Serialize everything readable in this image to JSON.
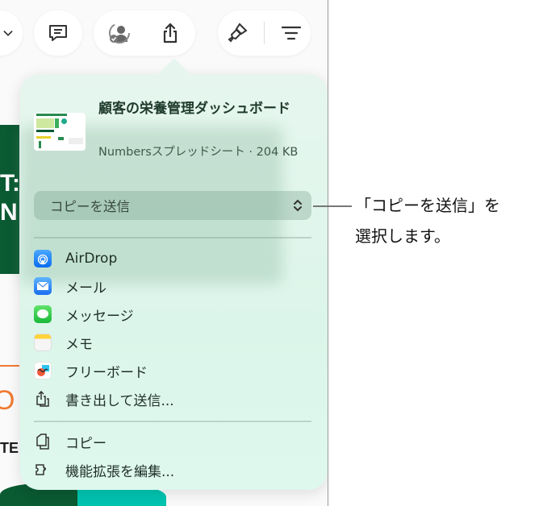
{
  "toolbar": {
    "icons": [
      "chevron-down-icon",
      "comment-icon",
      "collaborate-icon",
      "share-icon",
      "format-brush-icon",
      "organize-menu-icon"
    ]
  },
  "background": {
    "text_a": "T:",
    "text_b": "N",
    "text_c": "O",
    "text_d": "TE"
  },
  "share_sheet": {
    "title": "顧客の栄養管理ダッシュボード",
    "subtitle": "Numbersスプレッドシート · 204 KB",
    "send_mode": "コピーを送信",
    "items": [
      {
        "label": "AirDrop",
        "icon": "airdrop-icon"
      },
      {
        "label": "メール",
        "icon": "mail-icon"
      },
      {
        "label": "メッセージ",
        "icon": "messages-icon"
      },
      {
        "label": "メモ",
        "icon": "notes-icon"
      },
      {
        "label": "フリーボード",
        "icon": "freeform-icon"
      },
      {
        "label": "書き出して送信...",
        "icon": "export-icon"
      }
    ],
    "actions": [
      {
        "label": "コピー",
        "icon": "copy-icon"
      },
      {
        "label": "機能拡張を編集...",
        "icon": "extension-icon"
      }
    ]
  },
  "callout": {
    "line1": "「コピーを送信」を",
    "line2": "選択します。"
  }
}
